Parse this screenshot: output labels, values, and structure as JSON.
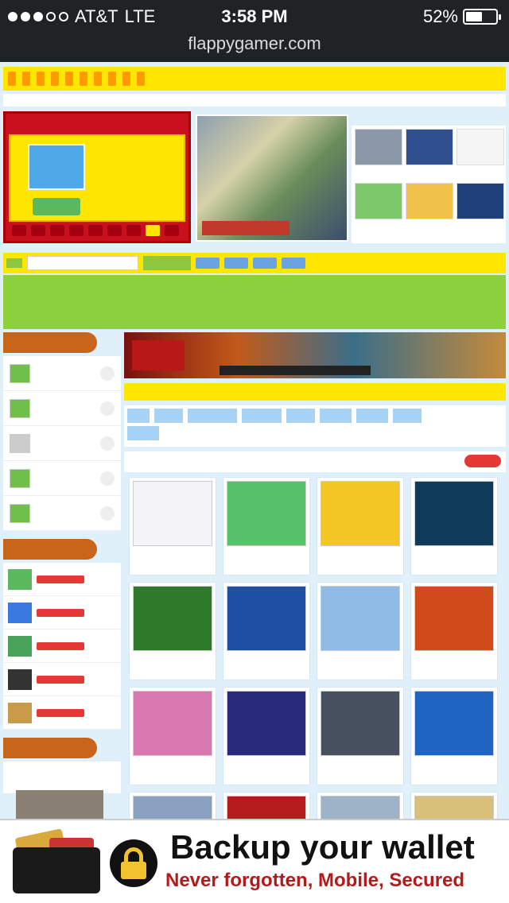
{
  "status": {
    "carrier": "AT&T",
    "network": "LTE",
    "time": "3:58 PM",
    "battery": "52%"
  },
  "browser": {
    "url": "flappygamer.com"
  },
  "ad": {
    "title": "Backup your wallet",
    "subtitle": "Never forgotten, Mobile, Secured"
  }
}
